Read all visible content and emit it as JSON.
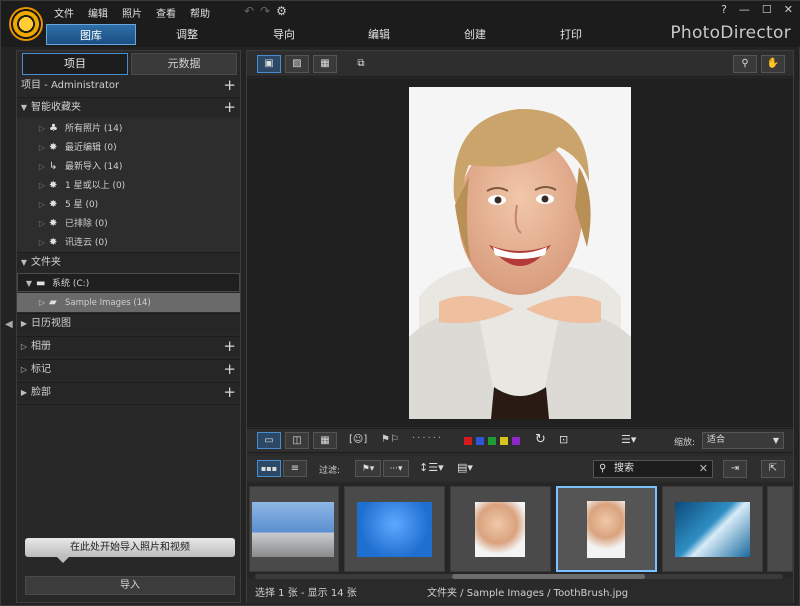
{
  "window": {
    "menu": [
      "文件",
      "编辑",
      "照片",
      "查看",
      "帮助"
    ],
    "help_btn": "?",
    "min_btn": "—",
    "max_btn": "☐",
    "close_btn": "✕",
    "brand": "PhotoDirector"
  },
  "modules": [
    "图库",
    "调整",
    "导向",
    "编辑",
    "创建",
    "打印"
  ],
  "active_module": "图库",
  "left_panel": {
    "tabs": [
      "项目",
      "元数据"
    ],
    "project_header": "项目 - Administrator",
    "smart_collections": {
      "label": "智能收藏夹",
      "items": [
        {
          "label": "所有照片 (14)",
          "icon": "tree-icon"
        },
        {
          "label": "最近编辑 (0)",
          "icon": "sparkle-icon"
        },
        {
          "label": "最新导入 (14)",
          "icon": "import-icon"
        },
        {
          "label": "1 星或以上 (0)",
          "icon": "sparkle-icon"
        },
        {
          "label": "5 星 (0)",
          "icon": "sparkle-icon"
        },
        {
          "label": "已排除 (0)",
          "icon": "sparkle-icon"
        },
        {
          "label": "讯连云 (0)",
          "icon": "sparkle-icon"
        }
      ]
    },
    "folders": {
      "label": "文件夹",
      "drive": "系统 (C:)",
      "sample_folder": "Sample Images (14)"
    },
    "calendar": "日历视图",
    "albums": "相册",
    "tags": "标记",
    "faces": "脸部",
    "import_tip": "在此处开始导入照片和视频",
    "import_button": "导入"
  },
  "viewer": {
    "zoom_label": "缩放:",
    "zoom_value": "适合",
    "filter_label": "过滤:",
    "search_value": "搜索",
    "color_labels": [
      "#d01c1c",
      "#2d57d6",
      "#1f9b35",
      "#d6c31b",
      "#8b28c9"
    ]
  },
  "status": {
    "selection": "选择 1 张 - 显示 14 张",
    "path": "文件夹 / Sample Images / ToothBrush.jpg"
  }
}
